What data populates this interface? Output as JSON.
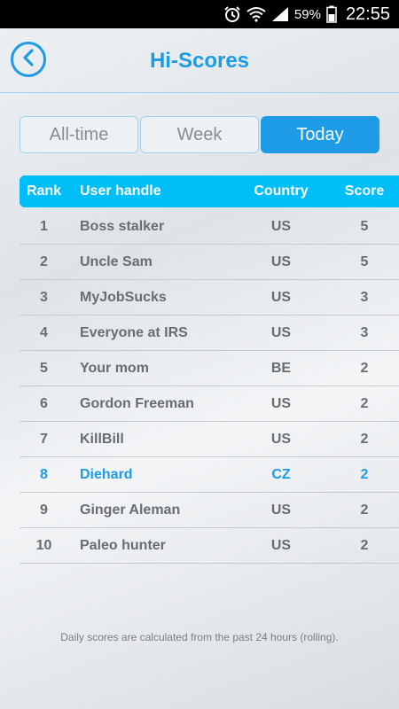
{
  "status_bar": {
    "battery": "59%",
    "time": "22:55"
  },
  "header": {
    "title": "Hi-Scores"
  },
  "tabs": [
    {
      "label": "All-time",
      "active": false
    },
    {
      "label": "Week",
      "active": false
    },
    {
      "label": "Today",
      "active": true
    }
  ],
  "table": {
    "columns": {
      "rank": "Rank",
      "user": "User handle",
      "country": "Country",
      "score": "Score"
    },
    "rows": [
      {
        "rank": "1",
        "user": "Boss stalker",
        "country": "US",
        "score": "5"
      },
      {
        "rank": "2",
        "user": "Uncle Sam",
        "country": "US",
        "score": "5"
      },
      {
        "rank": "3",
        "user": "MyJobSucks",
        "country": "US",
        "score": "3"
      },
      {
        "rank": "4",
        "user": "Everyone at IRS",
        "country": "US",
        "score": "3"
      },
      {
        "rank": "5",
        "user": "Your mom",
        "country": "BE",
        "score": "2"
      },
      {
        "rank": "6",
        "user": "Gordon Freeman",
        "country": "US",
        "score": "2"
      },
      {
        "rank": "7",
        "user": "KillBill",
        "country": "US",
        "score": "2"
      },
      {
        "rank": "8",
        "user": "Diehard",
        "country": "CZ",
        "score": "2"
      },
      {
        "rank": "9",
        "user": "Ginger Aleman",
        "country": "US",
        "score": "2"
      },
      {
        "rank": "10",
        "user": "Paleo hunter",
        "country": "US",
        "score": "2"
      }
    ],
    "highlighted_rank": "8"
  },
  "footer": {
    "note": "Daily scores are calculated from the past 24 hours (rolling)."
  },
  "colors": {
    "accent": "#1e9be6",
    "table_header": "#00bff8"
  }
}
